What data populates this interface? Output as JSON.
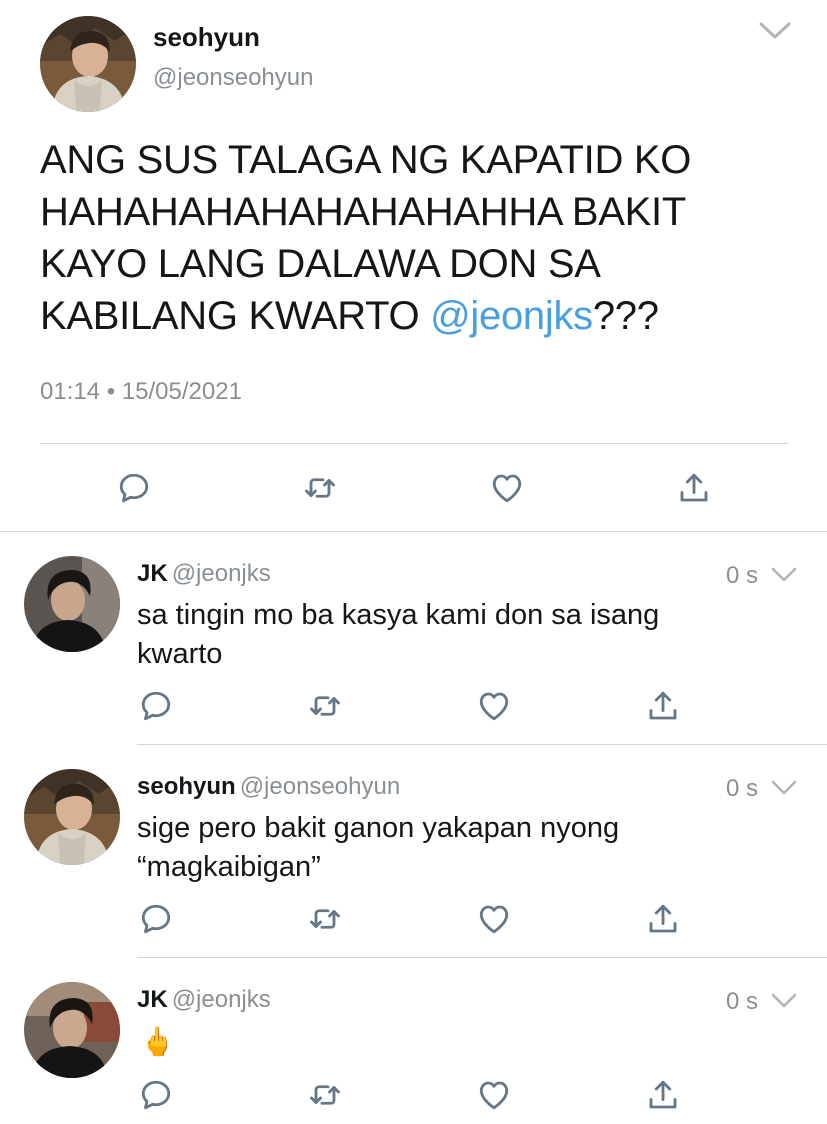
{
  "main_tweet": {
    "name": "seohyun",
    "handle": "@jeonseohyun",
    "text_lines": [
      "ANG SUS TALAGA NG KAPATID KO",
      "HAHAHAHAHAHAHAHAHHA BAKIT",
      "KAYO LANG DALAWA DON SA",
      "KABILANG KWARTO "
    ],
    "mention": "@jeonjks",
    "text_suffix": "???",
    "timestamp": "01:14 • 15/05/2021",
    "actions": [
      "reply-icon",
      "retweet-icon",
      "like-icon",
      "share-icon"
    ]
  },
  "replies": [
    {
      "name": "JK",
      "handle": "@jeonjks",
      "time": "0 s",
      "text_lines": [
        "sa tingin mo ba kasya kami don sa isang",
        "kwarto"
      ]
    },
    {
      "name": "seohyun",
      "handle": "@jeonseohyun",
      "time": "0 s",
      "text_lines": [
        "sige pero bakit ganon yakapan nyong",
        "“magkaibigan”"
      ]
    },
    {
      "name": "JK",
      "handle": "@jeonjks",
      "time": "0 s",
      "text_lines": [
        "🖕"
      ]
    }
  ],
  "colors": {
    "text": "#14171a",
    "secondary": "#8a8f94",
    "link": "#4a9fe0",
    "divider": "#d4d6d8",
    "icon": "#657786"
  }
}
